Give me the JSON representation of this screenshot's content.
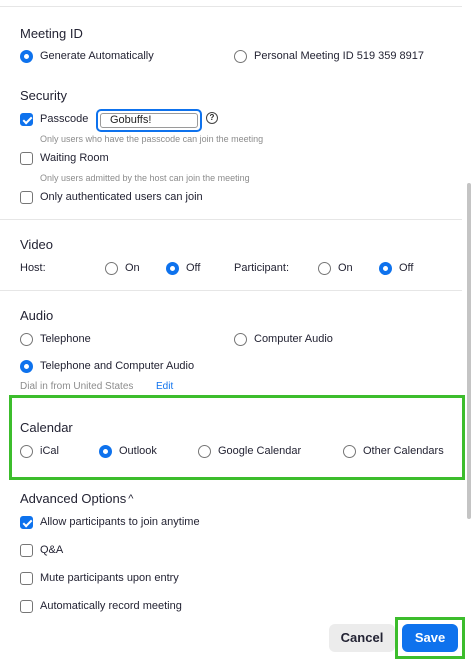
{
  "meeting_id": {
    "title": "Meeting ID",
    "generate_label": "Generate Automatically",
    "personal_label": "Personal Meeting ID 519 359 8917"
  },
  "security": {
    "title": "Security",
    "passcode_label": "Passcode",
    "passcode_value": "Gobuffs!",
    "passcode_hint": "Only users who have the passcode can join the meeting",
    "help_icon": "?",
    "waiting_room_label": "Waiting Room",
    "waiting_room_hint": "Only users admitted by the host can join the meeting",
    "auth_label": "Only authenticated users can join"
  },
  "video": {
    "title": "Video",
    "host_label": "Host:",
    "host_on": "On",
    "host_off": "Off",
    "participant_label": "Participant:",
    "participant_on": "On",
    "participant_off": "Off"
  },
  "audio": {
    "title": "Audio",
    "telephone": "Telephone",
    "computer": "Computer Audio",
    "both": "Telephone and Computer Audio",
    "dial_in": "Dial in from United States",
    "edit": "Edit"
  },
  "calendar": {
    "title": "Calendar",
    "ical": "iCal",
    "outlook": "Outlook",
    "google": "Google Calendar",
    "other": "Other Calendars"
  },
  "advanced": {
    "title": "Advanced Options",
    "chevron": "^",
    "allow_anytime": "Allow participants to join anytime",
    "qa": "Q&A",
    "mute": "Mute participants upon entry",
    "record": "Automatically record meeting"
  },
  "footer": {
    "cancel": "Cancel",
    "save": "Save"
  },
  "colors": {
    "accent": "#0e72ed",
    "highlight": "#3cbd2c"
  }
}
